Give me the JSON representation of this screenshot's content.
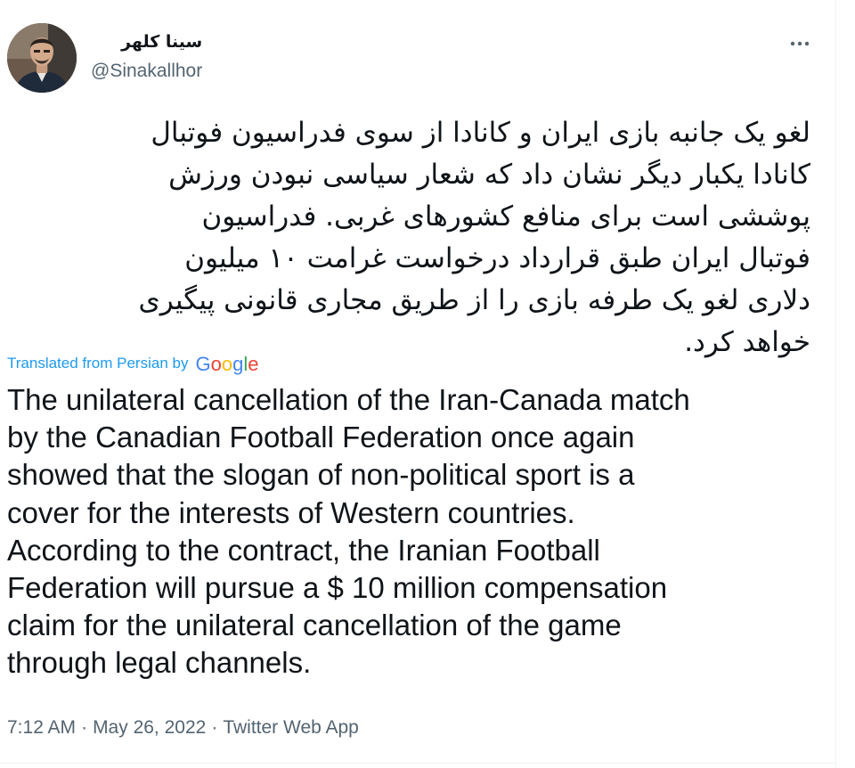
{
  "tweet": {
    "author": {
      "display_name": "سینا کلهر",
      "handle": "@Sinakallhor"
    },
    "more_icon": "ellipsis-icon",
    "persian_lines": [
      "لغو یک جانبه بازی ایران و کانادا از سوی فدراسیون فوتبال",
      "کانادا یکبار دیگر نشان داد که شعار سیاسی نبودن ورزش",
      "پوششی است برای منافع کشورهای غربی. فدراسیون",
      "فوتبال ایران طبق قرارداد درخواست غرامت ۱۰ میلیون",
      "دلاری لغو یک طرفه بازی را از طریق مجاری قانونی پیگیری",
      "خواهد کرد."
    ],
    "translation": {
      "label": "Translated from Persian by",
      "provider": "Google"
    },
    "english_lines": [
      "The unilateral cancellation of the Iran-Canada match",
      "by the Canadian Football Federation once again",
      "showed that the slogan of non-political sport is a",
      "cover for the interests of Western countries.",
      "According to the contract, the Iranian Football",
      "Federation will pursue a $ 10 million compensation",
      "claim for the unilateral cancellation of the game",
      "through legal channels."
    ],
    "meta": {
      "time": "7:12 AM",
      "separator": "·",
      "date": "May 26, 2022",
      "source": "Twitter Web App"
    }
  },
  "colors": {
    "text_primary": "#0f1419",
    "text_secondary": "#536471",
    "link_blue": "#1d9bf0",
    "google_blue": "#4285f4",
    "google_red": "#ea4335",
    "google_yellow": "#fbbc05",
    "google_green": "#34a853",
    "border": "#eff3f4"
  }
}
